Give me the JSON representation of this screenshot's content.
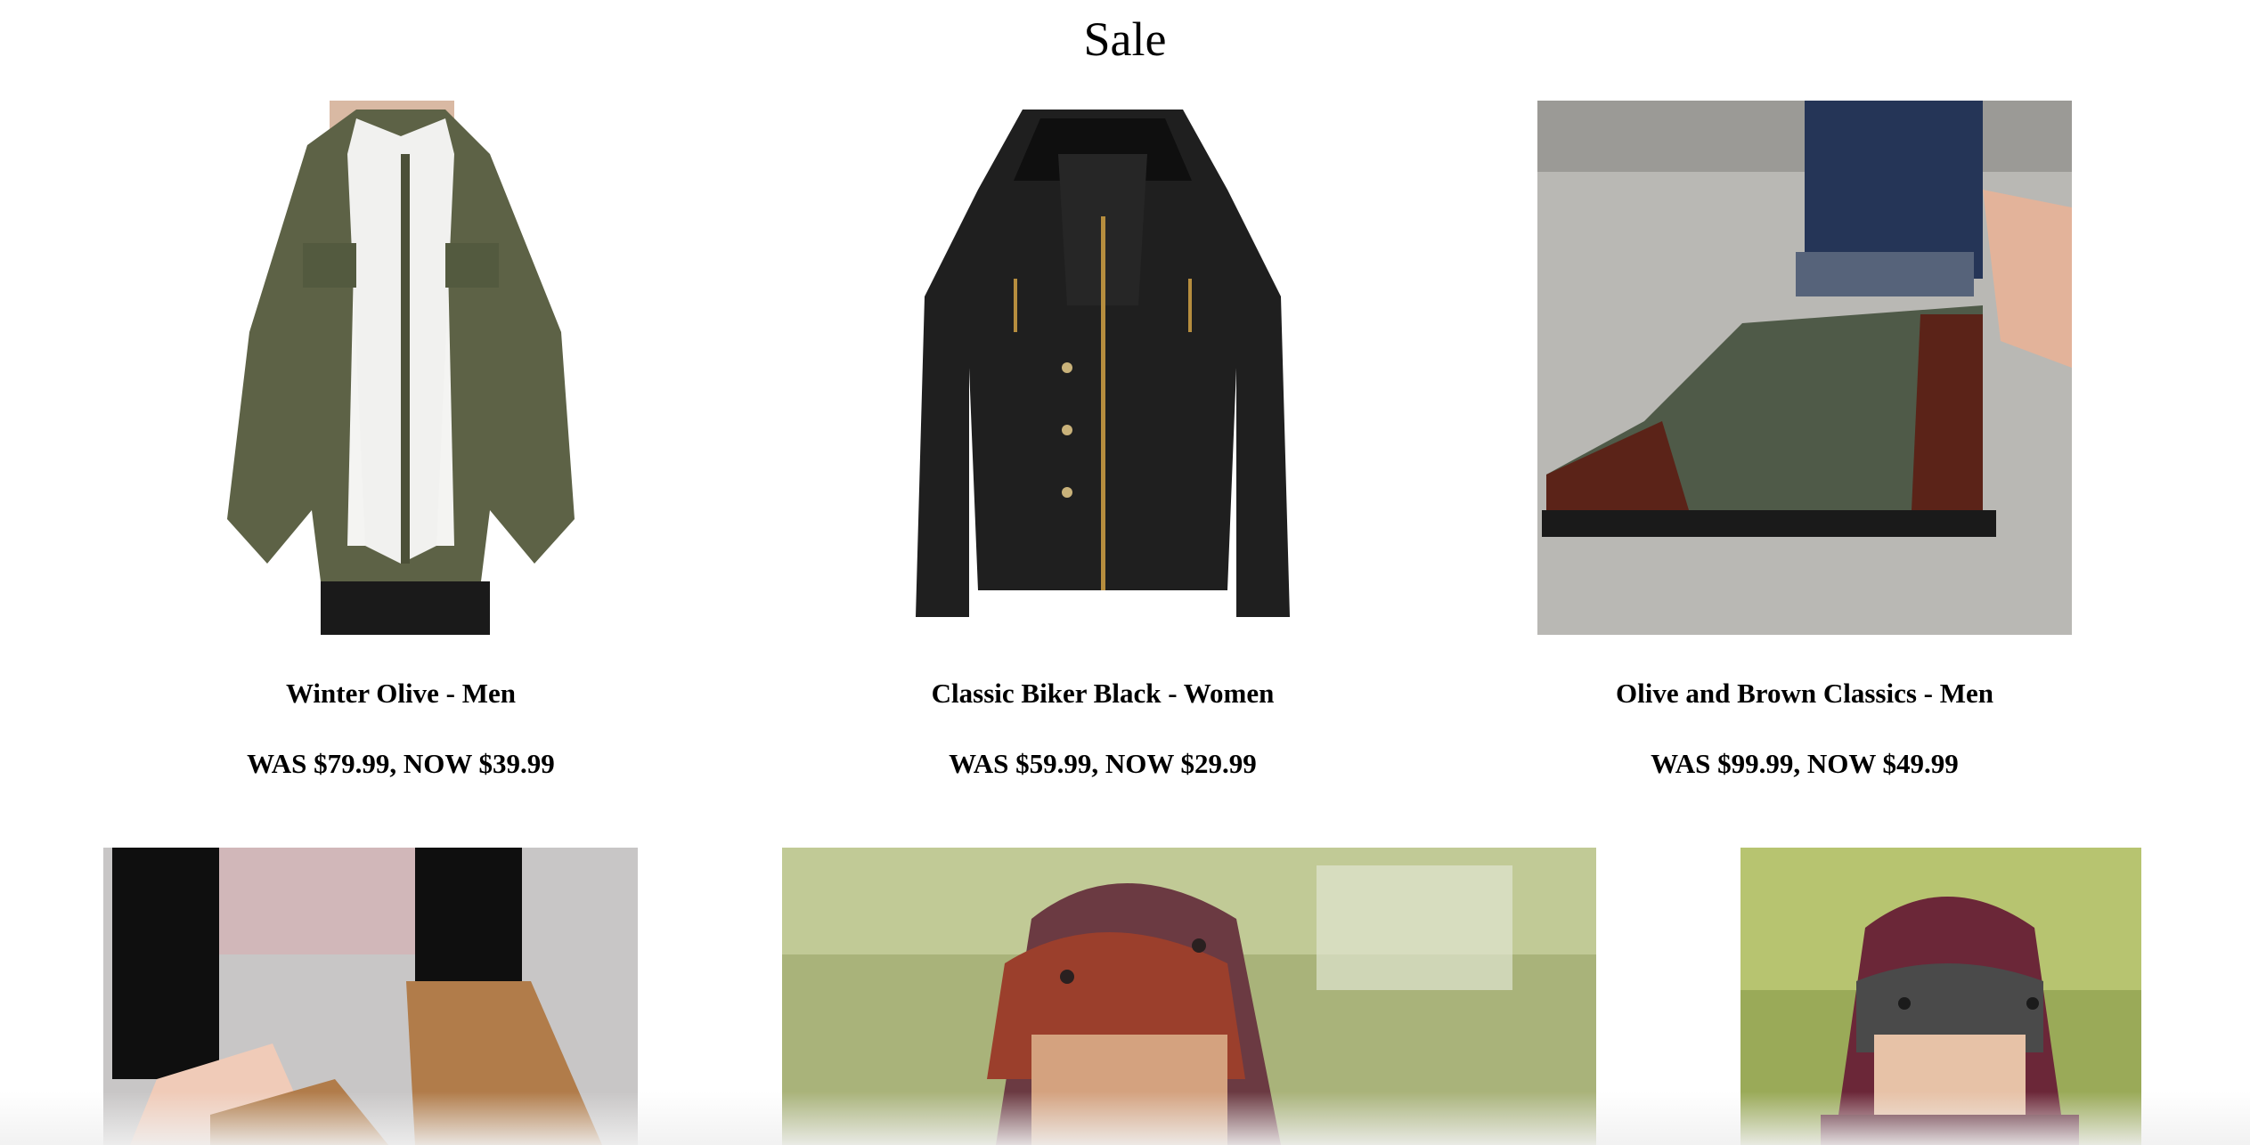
{
  "page": {
    "title": "Sale"
  },
  "products": [
    {
      "name": "Winter Olive - Men",
      "price": "WAS $79.99, NOW $39.99"
    },
    {
      "name": "Classic Biker Black - Women",
      "price": "WAS $59.99, NOW $29.99"
    },
    {
      "name": "Olive and Brown Classics - Men",
      "price": "WAS $99.99, NOW $49.99"
    }
  ],
  "images": [
    "olive parka jacket",
    "black biker jacket",
    "olive and brown boot",
    "tan oxford shoes",
    "red knit trapper hat",
    "burgundy gray knit hat"
  ]
}
